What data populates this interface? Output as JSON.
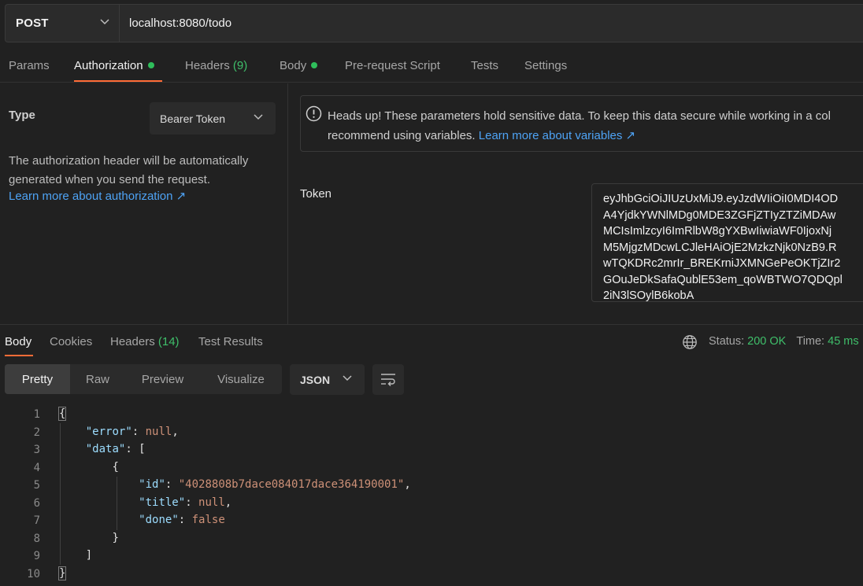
{
  "request": {
    "method": "POST",
    "url": "localhost:8080/todo"
  },
  "request_tabs": [
    {
      "label": "Params"
    },
    {
      "label": "Authorization",
      "dot": true
    },
    {
      "label": "Headers",
      "count": "(9)"
    },
    {
      "label": "Body",
      "dot": true
    },
    {
      "label": "Pre-request Script"
    },
    {
      "label": "Tests"
    },
    {
      "label": "Settings"
    }
  ],
  "auth": {
    "type_label": "Type",
    "type_value": "Bearer Token",
    "description": "The authorization header will be automatically generated when you send the request.",
    "learn_more": "Learn more about authorization ↗",
    "notice_text": "Heads up! These parameters hold sensitive data. To keep this data secure while working in a col",
    "notice_text_2": "recommend using variables.",
    "notice_link": "Learn more about variables ↗",
    "token_label": "Token",
    "token_lines": [
      "eyJhbGciOiJIUzUxMiJ9.eyJzdWIiOiI0MDI4OD",
      "A4YjdkYWNlMDg0MDE3ZGFjZTIyZTZiMDAw",
      "MCIsImlzcyI6ImRlbW8gYXBwIiwiaWF0IjoxNj",
      "M5MjgzMDcwLCJleHAiOjE2MzkzNjk0NzB9.R",
      "wTQKDRc2mrIr_BREKrniJXMNGePeOKTjZIr2",
      "GOuJeDkSafaQublE53em_qoWBTWO7QDQpl",
      "2iN3lSOylB6kobA"
    ]
  },
  "response": {
    "tabs": [
      {
        "label": "Body"
      },
      {
        "label": "Cookies"
      },
      {
        "label": "Headers",
        "count": "(14)"
      },
      {
        "label": "Test Results"
      }
    ],
    "status_label": "Status:",
    "status_value": "200 OK",
    "time_label": "Time:",
    "time_value": "45 ms",
    "format_tabs": [
      "Pretty",
      "Raw",
      "Preview",
      "Visualize"
    ],
    "format_select": "JSON"
  },
  "code_lines": [
    {
      "n": "1",
      "text": "{"
    },
    {
      "n": "2",
      "key": "error",
      "value": "null"
    },
    {
      "n": "3",
      "key": "data",
      "value": "["
    },
    {
      "n": "4",
      "text": "{"
    },
    {
      "n": "5",
      "key": "id",
      "value": "\"4028808b7dace084017dace364190001\""
    },
    {
      "n": "6",
      "key": "title",
      "value": "null"
    },
    {
      "n": "7",
      "key": "done",
      "value": "false"
    },
    {
      "n": "8",
      "text": "}"
    },
    {
      "n": "9",
      "text": "]"
    },
    {
      "n": "10",
      "text": "}"
    }
  ],
  "colors": {
    "accent": "#ff6c37",
    "link": "#4ea3f5",
    "success": "#3fbf6a",
    "json_key": "#9cdcfe",
    "json_value": "#ce9178"
  }
}
